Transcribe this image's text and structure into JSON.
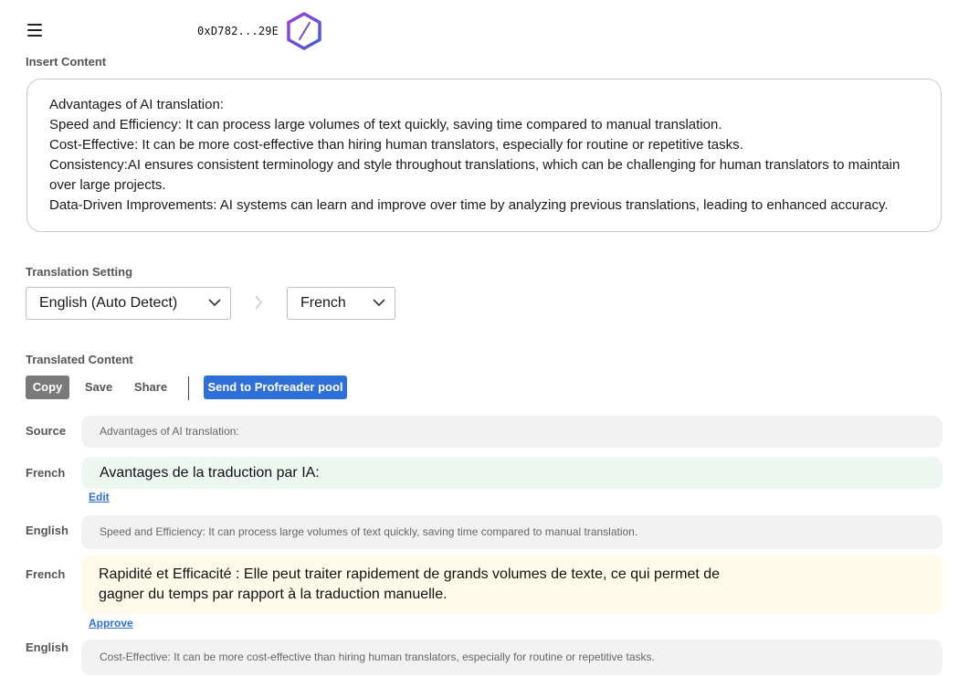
{
  "header": {
    "wallet_address": "0xD782...29E"
  },
  "insert": {
    "label": "Insert Content",
    "lines": [
      "Advantages of AI translation:",
      "Speed and Efficiency: It can process large volumes of text quickly, saving time compared to manual translation.",
      "Cost-Effective: It can be more cost-effective than hiring human translators, especially for routine or repetitive tasks.",
      "Consistency:AI ensures consistent terminology and style throughout translations, which can be challenging for human translators to maintain over large projects.",
      "Data-Driven Improvements: AI systems can learn and improve over time by analyzing previous translations, leading to enhanced accuracy."
    ]
  },
  "settings": {
    "label": "Translation Setting",
    "source_language": "English (Auto Detect)",
    "target_language": "French"
  },
  "translated": {
    "label": "Translated Content",
    "toolbar": {
      "copy": "Copy",
      "save": "Save",
      "share": "Share",
      "send": "Send to Profreader pool"
    },
    "rows": [
      {
        "label": "Source",
        "text": "Advantages of AI translation:"
      },
      {
        "label": "French",
        "text": "Avantages de la traduction par IA:",
        "action": "Edit"
      },
      {
        "label": "English",
        "text": "Speed and Efficiency: It can process large volumes of text quickly, saving time compared to manual translation."
      },
      {
        "label": "French",
        "line1": "Rapidité et Efficacité : Elle peut traiter rapidement de grands volumes de texte, ce qui permet de",
        "line2": "gagner du temps par rapport à la traduction manuelle.",
        "action": "Approve"
      },
      {
        "label": "English",
        "text": "Cost-Effective: It can be more cost-effective than hiring human translators, especially for routine or repetitive tasks."
      }
    ]
  },
  "colors": {
    "primary_button": "#2f6fd9",
    "copy_button": "#7a7a7a",
    "approved_row_bg": "#eef8f3",
    "pending_row_bg": "#fefbea",
    "source_row_bg": "#f2f2f2",
    "logo_gradient_start": "#8a3ad6",
    "logo_gradient_end": "#3a5fd6"
  },
  "icons": [
    "menu-icon",
    "logo-icon",
    "chevron-down-icon",
    "chevron-right-icon"
  ]
}
